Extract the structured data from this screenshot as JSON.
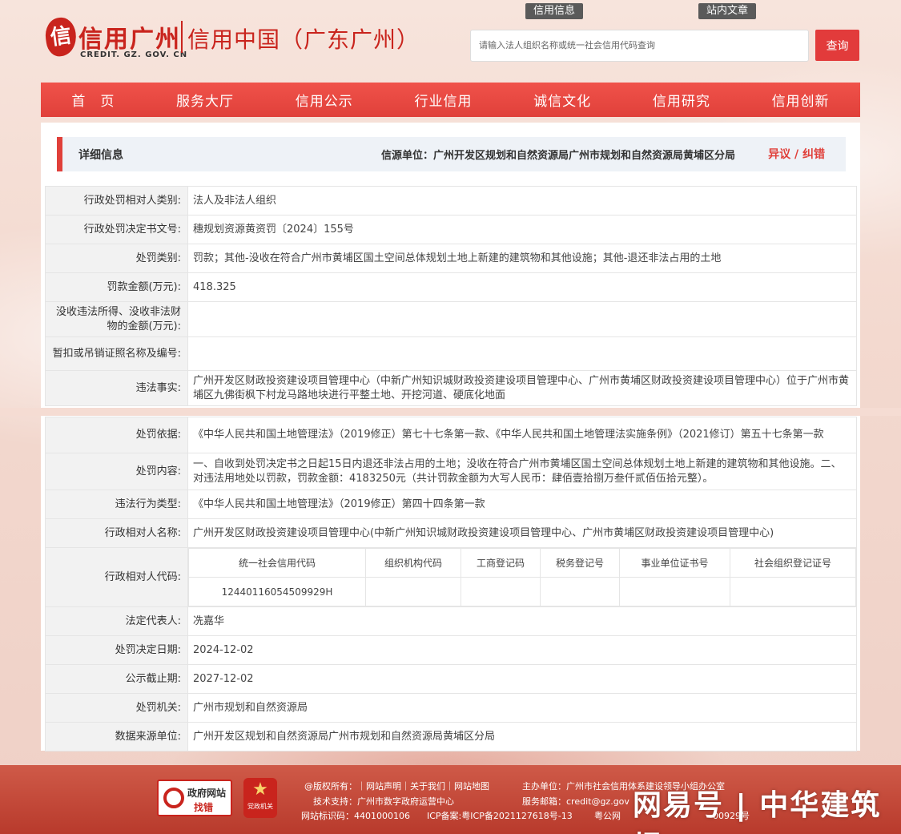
{
  "header": {
    "logo_mark": "信",
    "logo_name": "信用广州",
    "logo_sub": "CREDIT. GZ. GOV. CN",
    "logo_cn": "信用中国（广东广州）",
    "tag_credit_info": "信用信息",
    "tag_site_article": "站内文章",
    "search_placeholder": "请输入法人组织名称或统一社会信用代码查询",
    "search_button": "查询"
  },
  "nav": [
    "首　页",
    "服务大厅",
    "信用公示",
    "行业信用",
    "诚信文化",
    "信用研究",
    "信用创新"
  ],
  "detail": {
    "title": "详细信息",
    "source": "信源单位：广州开发区规划和自然资源局广州市规划和自然资源局黄埔区分局",
    "objection": "异议 / 纠错"
  },
  "rows_top": [
    {
      "label": "行政处罚相对人类别:",
      "value": "法人及非法人组织"
    },
    {
      "label": "行政处罚决定书文号:",
      "value": "穗规划资源黄资罚〔2024〕155号"
    },
    {
      "label": "处罚类别:",
      "value": "罚款；其他-没收在符合广州市黄埔区国土空间总体规划土地上新建的建筑物和其他设施；其他-退还非法占用的土地"
    },
    {
      "label": "罚款金额(万元):",
      "value": "418.325"
    },
    {
      "label": "没收违法所得、没收非法财物的金额(万元):",
      "value": ""
    },
    {
      "label": "暂扣或吊销证照名称及编号:",
      "value": ""
    },
    {
      "label": "违法事实:",
      "value": "广州开发区财政投资建设项目管理中心（中新广州知识城财政投资建设项目管理中心、广州市黄埔区财政投资建设项目管理中心）位于广州市黄埔区九佛街枫下村龙马路地块进行平整土地、开挖河道、硬底化地面"
    }
  ],
  "rows_bottom": [
    {
      "label": "处罚依据:",
      "value": "《中华人民共和国土地管理法》（2019修正）第七十七条第一款、《中华人民共和国土地管理法实施条例》（2021修订）第五十七条第一款"
    },
    {
      "label": "处罚内容:",
      "value": "一、自收到处罚决定书之日起15日内退还非法占用的土地；没收在符合广州市黄埔区国土空间总体规划土地上新建的建筑物和其他设施。二、对违法用地处以罚款，罚款金额：4183250元（共计罚款金额为大写人民币：肆佰壹拾捌万叁仟贰佰伍拾元整）。"
    },
    {
      "label": "违法行为类型:",
      "value": "《中华人民共和国土地管理法》（2019修正）第四十四条第一款"
    },
    {
      "label": "行政相对人名称:",
      "value": "广州开发区财政投资建设项目管理中心(中新广州知识城财政投资建设项目管理中心、广州市黄埔区财政投资建设项目管理中心)"
    }
  ],
  "codes": {
    "label": "行政相对人代码:",
    "headers": [
      "统一社会信用代码",
      "组织机构代码",
      "工商登记码",
      "税务登记号",
      "事业单位证书号",
      "社会组织登记证号"
    ],
    "values": [
      "12440116054509929H",
      "",
      "",
      "",
      "",
      ""
    ]
  },
  "rows_tail": [
    {
      "label": "法定代表人:",
      "value": "冼嘉华"
    },
    {
      "label": "处罚决定日期:",
      "value": "2024-12-02"
    },
    {
      "label": "公示截止期:",
      "value": "2027-12-02"
    },
    {
      "label": "处罚机关:",
      "value": "广州市规划和自然资源局"
    },
    {
      "label": "数据来源单位:",
      "value": "广州开发区规划和自然资源局广州市规划和自然资源局黄埔区分局"
    }
  ],
  "footer": {
    "gov_badge_title": "政府网站",
    "gov_badge_action": "找错",
    "party_badge_text": "党政机关",
    "line1_left": "@版权所有：｜网站声明｜关于我们｜网站地图",
    "line1_right": "主办单位：广州市社会信用体系建设领导小组办公室",
    "line2_left": "技术支持：广州市数字政府运营中心",
    "line2_right": "服务邮箱：credit@gz.gov",
    "line3_left": "网站标识码：4401000106",
    "line3_mid": "ICP备案:粤ICP备2021127618号-13",
    "line3_right": "粤公网",
    "line3_tail": "00929号"
  },
  "watermark": "网易号 | 中华建筑报"
}
